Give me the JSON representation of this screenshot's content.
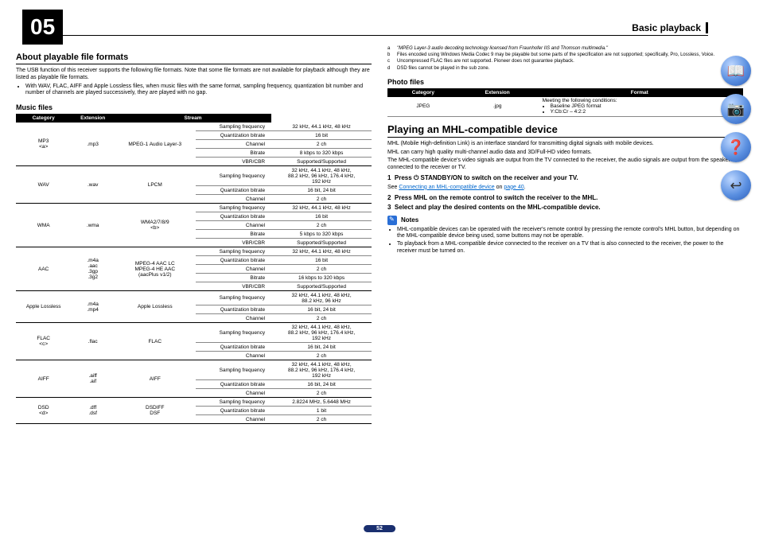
{
  "chapter": "05",
  "header": "Basic playback",
  "pagenum": "52",
  "left": {
    "h_about": "About playable file formats",
    "p_intro": "The USB function of this receiver supports the following file formats. Note that some file formats are not available for playback although they are listed as playable file formats.",
    "bul_gapless": "With WAV, FLAC, AIFF and Apple Lossless files, when music files with the same format, sampling frequency, quantization bit number and number of channels are played successively, they are played with no gap.",
    "h_music": "Music files",
    "th_cat": "Category",
    "th_ext": "Extension",
    "th_stream": "Stream",
    "rows": [
      {
        "cat": "MP3\n<a>",
        "ext": ".mp3",
        "stream": "MPEG-1 Audio Layer-3",
        "specs": [
          [
            "Sampling frequency",
            "32 kHz, 44.1 kHz, 48 kHz"
          ],
          [
            "Quantization bitrate",
            "16 bit"
          ],
          [
            "Channel",
            "2 ch"
          ],
          [
            "Bitrate",
            "8 kbps to 320 kbps"
          ],
          [
            "VBR/CBR",
            "Supported/Supported"
          ]
        ]
      },
      {
        "cat": "WAV",
        "ext": ".wav",
        "stream": "LPCM",
        "specs": [
          [
            "Sampling frequency",
            "32 kHz, 44.1 kHz, 48 kHz,\n88.2 kHz, 96 kHz, 176.4 kHz,\n192 kHz"
          ],
          [
            "Quantization bitrate",
            "16 bit, 24 bit"
          ],
          [
            "Channel",
            "2 ch"
          ]
        ]
      },
      {
        "cat": "WMA",
        "ext": ".wma",
        "stream": "WMA2/7/8/9\n<b>",
        "specs": [
          [
            "Sampling frequency",
            "32 kHz, 44.1 kHz, 48 kHz"
          ],
          [
            "Quantization bitrate",
            "16 bit"
          ],
          [
            "Channel",
            "2 ch"
          ],
          [
            "Bitrate",
            "5 kbps to 320 kbps"
          ],
          [
            "VBR/CBR",
            "Supported/Supported"
          ]
        ]
      },
      {
        "cat": "AAC",
        "ext": ".m4a\n.aac\n.3gp\n.3g2",
        "stream": "MPEG-4 AAC LC\nMPEG-4 HE AAC\n(aacPlus v1/2)",
        "specs": [
          [
            "Sampling frequency",
            "32 kHz, 44.1 kHz, 48 kHz"
          ],
          [
            "Quantization bitrate",
            "16 bit"
          ],
          [
            "Channel",
            "2 ch"
          ],
          [
            "Bitrate",
            "16 kbps to 320 kbps"
          ],
          [
            "VBR/CBR",
            "Supported/Supported"
          ]
        ]
      },
      {
        "cat": "Apple Lossless",
        "ext": ".m4a\n.mp4",
        "stream": "Apple Lossless",
        "specs": [
          [
            "Sampling frequency",
            "32 kHz, 44.1 kHz, 48 kHz,\n88.2 kHz, 96 kHz"
          ],
          [
            "Quantization bitrate",
            "16 bit, 24 bit"
          ],
          [
            "Channel",
            "2 ch"
          ]
        ]
      },
      {
        "cat": "FLAC\n<c>",
        "ext": ".flac",
        "stream": "FLAC",
        "specs": [
          [
            "Sampling frequency",
            "32 kHz, 44.1 kHz, 48 kHz,\n88.2 kHz, 96 kHz, 176.4 kHz,\n192 kHz"
          ],
          [
            "Quantization bitrate",
            "16 bit, 24 bit"
          ],
          [
            "Channel",
            "2 ch"
          ]
        ]
      },
      {
        "cat": "AIFF",
        "ext": ".aiff\n.aif",
        "stream": "AIFF",
        "specs": [
          [
            "Sampling frequency",
            "32 kHz, 44.1 kHz, 48 kHz,\n88.2 kHz, 96 kHz, 176.4 kHz,\n192 kHz"
          ],
          [
            "Quantization bitrate",
            "16 bit, 24 bit"
          ],
          [
            "Channel",
            "2 ch"
          ]
        ]
      },
      {
        "cat": "DSD\n<d>",
        "ext": ".dff\n.dsf",
        "stream": "DSDIFF\nDSF",
        "specs": [
          [
            "Sampling frequency",
            "2.8224 MHz, 5.6448 MHz"
          ],
          [
            "Quantization bitrate",
            "1 bit"
          ],
          [
            "Channel",
            "2 ch"
          ]
        ]
      }
    ]
  },
  "right": {
    "fn_a": "\"MPEG Layer-3 audio decoding technology licensed from Fraunhofer IIS and Thomson multimedia.\"",
    "fn_b": "Files encoded using Windows Media Codec 9 may be playable but some parts of the specification are not supported; specifically, Pro, Lossless, Voice.",
    "fn_c": "Uncompressed FLAC files are not supported. Pioneer does not guarantee playback.",
    "fn_d": "DSD files cannot be played in the sub zone.",
    "h_photo": "Photo files",
    "th_cat": "Category",
    "th_ext": "Extension",
    "th_fmt": "Format",
    "photo_cat": "JPEG",
    "photo_ext": ".jpg",
    "photo_fmt_intro": "Meeting the following conditions:",
    "photo_fmt_b1": "Baseline JPEG format",
    "photo_fmt_b2": "Y:Cb:Cr – 4:2:2",
    "h_mhl": "Playing an MHL-compatible device",
    "p_mhl1": "MHL (Mobile High-definition Link) is an interface standard for transmitting digital signals with mobile devices.",
    "p_mhl2": "MHL can carry high quality multi-channel audio data and 3D/Full-HD video formats.",
    "p_mhl3": "The MHL-compatible device's video signals are output from the TV connected to the receiver, the audio signals are output from the speakers connected to the receiver or TV.",
    "step1_pre": "Press ",
    "step1_sym": "⏻",
    "step1_post": " STANDBY/ON to switch on the receiver and your TV.",
    "see": "See ",
    "link": "Connecting an MHL-compatible device",
    "on": " on ",
    "pg": "page 40",
    "dot": ".",
    "step2": "Press MHL on the remote control to switch the receiver to the MHL.",
    "step3": "Select and play the desired contents on the MHL-compatible device.",
    "notes": "Notes",
    "n1": "MHL-compatible devices can be operated with the receiver's remote control by pressing the remote control's MHL button, but depending on the MHL-compatible device being used, some buttons may not be operable.",
    "n2": "To playback from a MHL-compatible device connected to the receiver on a TV that is also connected to the receiver, the power to the receiver must be turned on."
  },
  "icons": [
    "📖",
    "📷",
    "❓",
    "↩"
  ]
}
